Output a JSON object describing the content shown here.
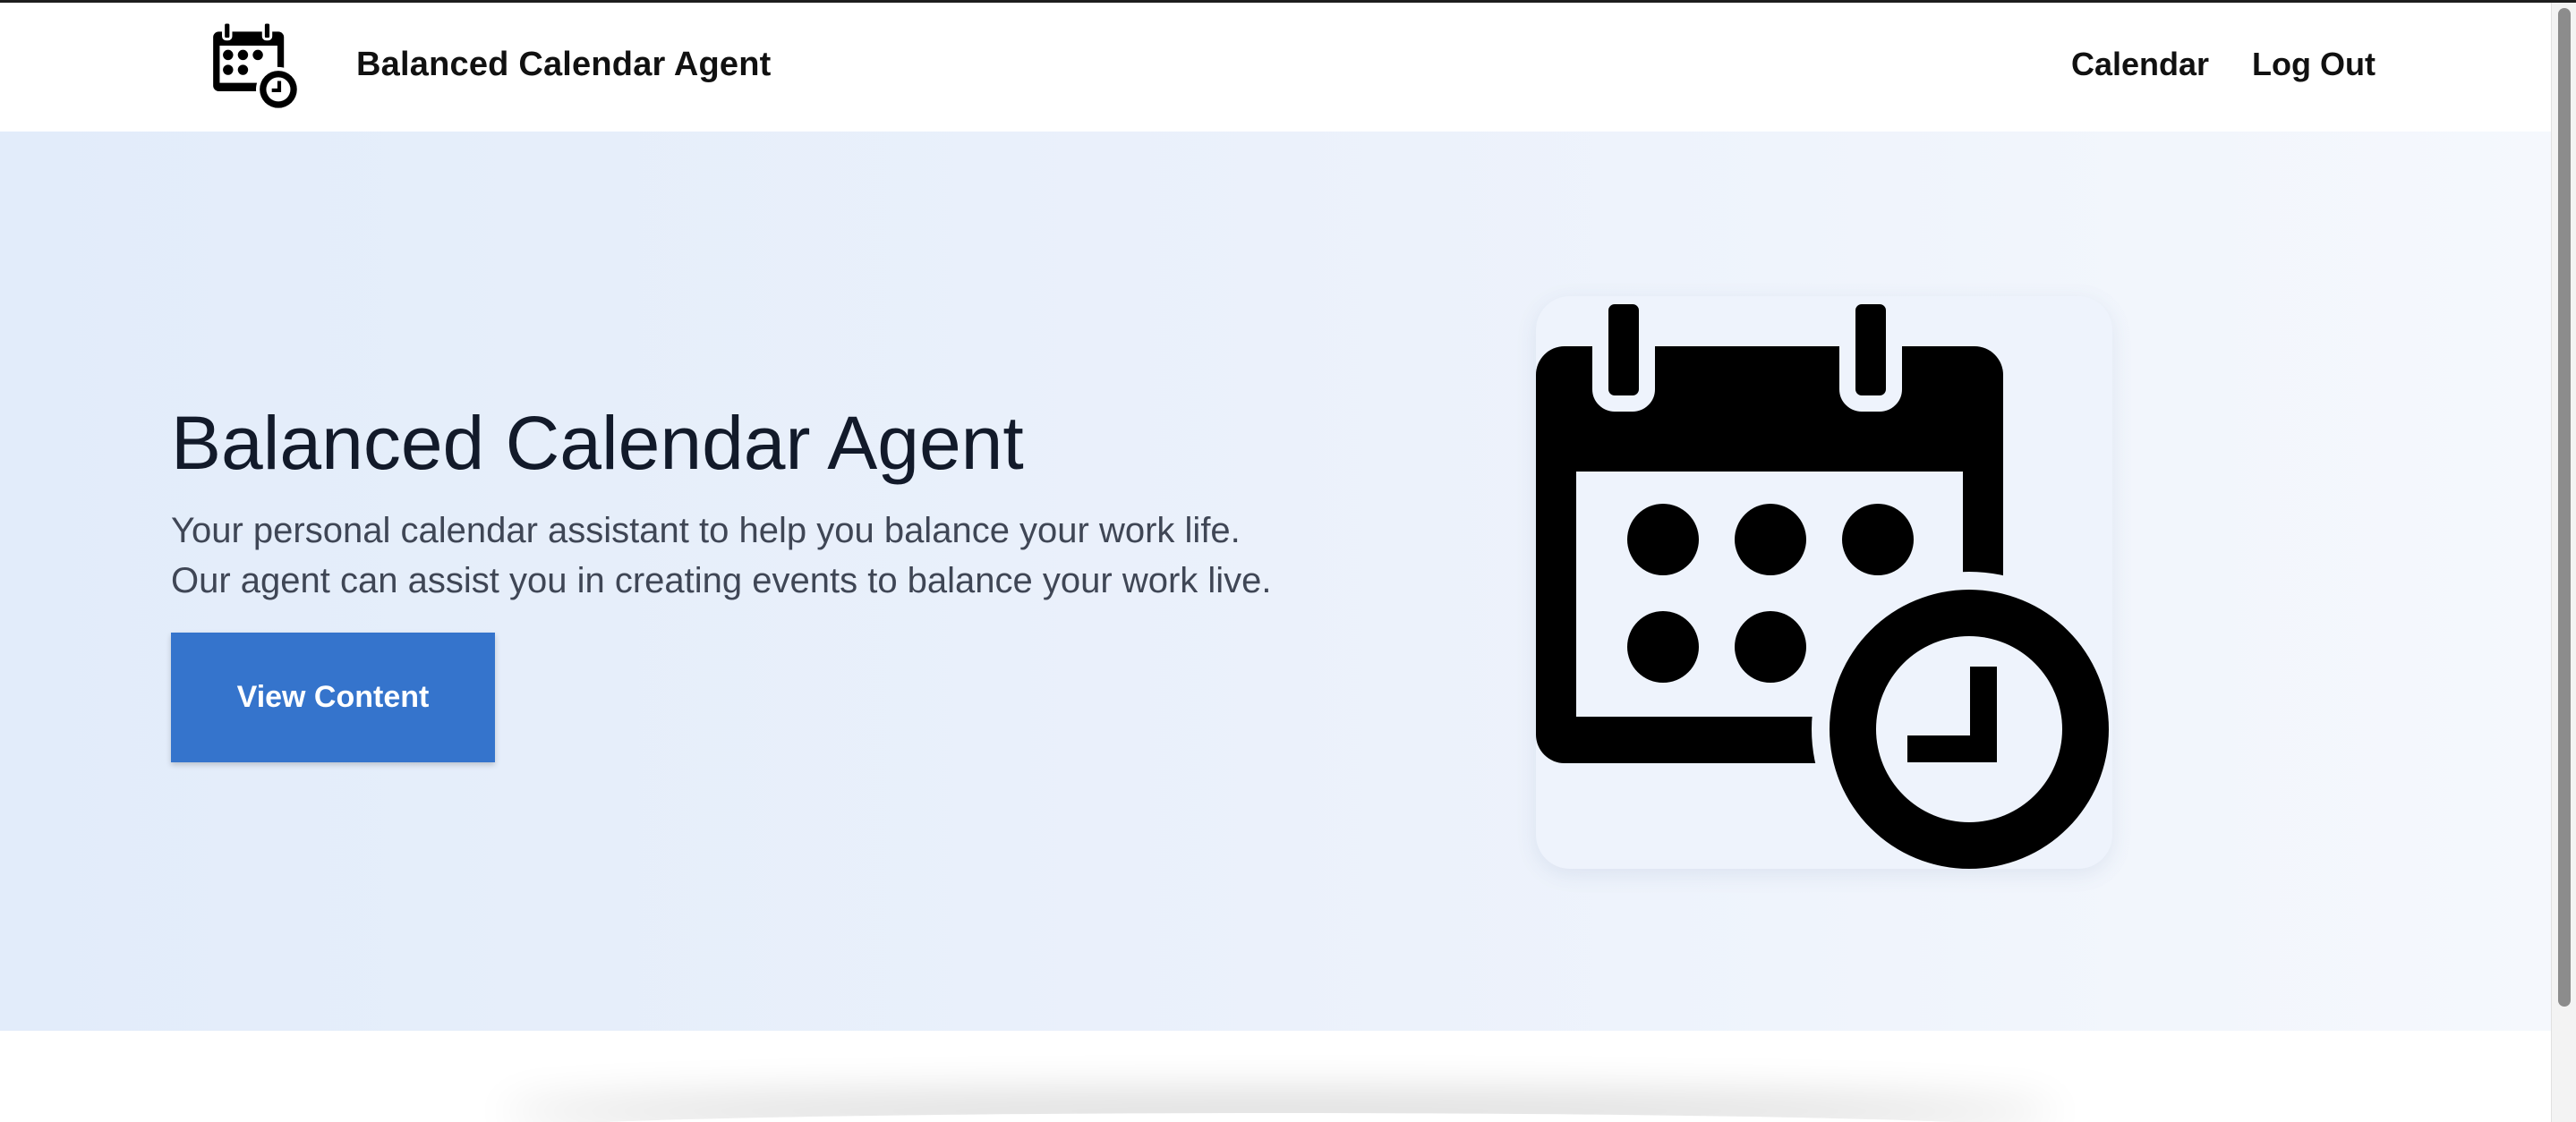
{
  "navbar": {
    "brand_name": "Balanced Calendar Agent",
    "logo_icon": "calendar-clock-icon",
    "links": [
      {
        "label": "Calendar"
      },
      {
        "label": "Log Out"
      }
    ]
  },
  "hero": {
    "title": "Balanced Calendar Agent",
    "subtitle_lines": [
      "Your personal calendar assistant to help you balance your work life.",
      "Our agent can assist you in creating events to balance your work live."
    ],
    "cta_label": "View Content",
    "image_icon": "calendar-clock-icon"
  },
  "colors": {
    "accent": "#3574cc",
    "hero_bg_start": "#e2ecfa",
    "hero_bg_end": "#f5f8fd",
    "text_dark": "#121a2a",
    "text_muted": "#3f4655"
  }
}
